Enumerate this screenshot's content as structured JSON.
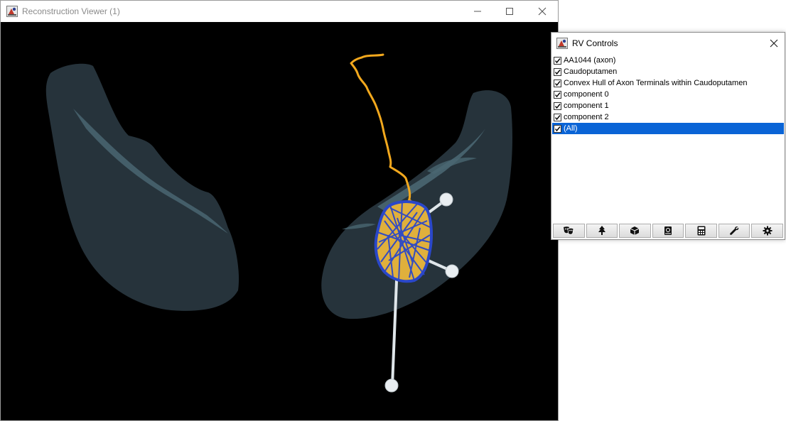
{
  "viewer": {
    "title": "Reconstruction Viewer (1)",
    "buttons": {
      "minimize": "minimize-icon",
      "maximize": "maximize-icon",
      "close": "close-icon"
    }
  },
  "controls": {
    "title": "RV Controls",
    "items": [
      {
        "label": "AA1044 (axon)",
        "checked": true,
        "selected": false
      },
      {
        "label": "Caudoputamen",
        "checked": true,
        "selected": false
      },
      {
        "label": "Convex Hull of Axon Terminals within Caudoputamen",
        "checked": true,
        "selected": false
      },
      {
        "label": "component 0",
        "checked": true,
        "selected": false
      },
      {
        "label": "component 1",
        "checked": true,
        "selected": false
      },
      {
        "label": "component 2",
        "checked": true,
        "selected": false
      },
      {
        "label": "(All)",
        "checked": true,
        "selected": true
      }
    ],
    "toolbar": [
      "theatre-masks-icon",
      "tree-icon",
      "cube-icon",
      "atlas-book-icon",
      "calculator-icon",
      "wrench-icon",
      "gear-icon"
    ]
  },
  "colors": {
    "canvas_bg": "#000000",
    "region": "#26333b",
    "region_highlight": "#4a6672",
    "axon": "#f2a81d",
    "hull": "#2a47c9",
    "components": "#dfe6ea",
    "selection": "#0a64d6"
  }
}
